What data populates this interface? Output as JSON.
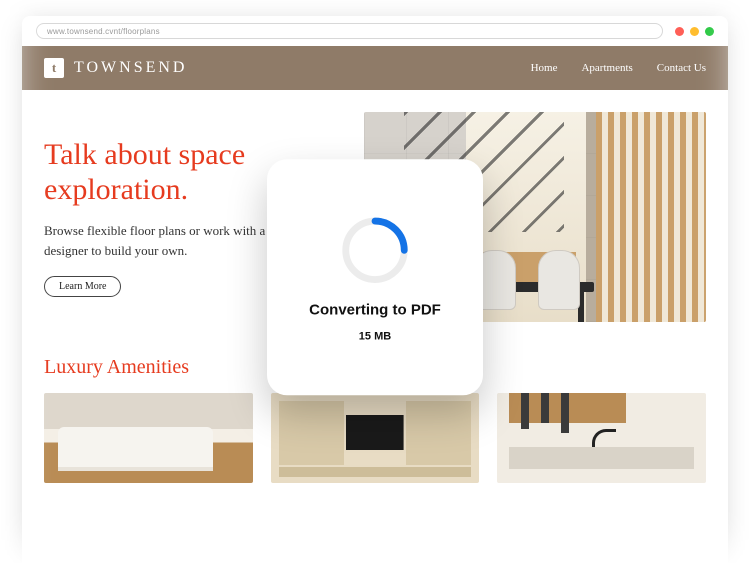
{
  "browser": {
    "url": "www.townsend.cvnt/floorplans"
  },
  "brand": {
    "badge": "t",
    "name": "TOWNSEND"
  },
  "nav": {
    "home": "Home",
    "apartments": "Apartments",
    "contact": "Contact Us"
  },
  "hero": {
    "title_l1": "Talk about space",
    "title_l2": "exploration.",
    "sub": "Browse flexible floor plans or work with a designer to build your own.",
    "cta": "Learn More"
  },
  "amenities": {
    "title": "Luxury Amenities"
  },
  "modal": {
    "title": "Converting to PDF",
    "size": "15 MB"
  }
}
